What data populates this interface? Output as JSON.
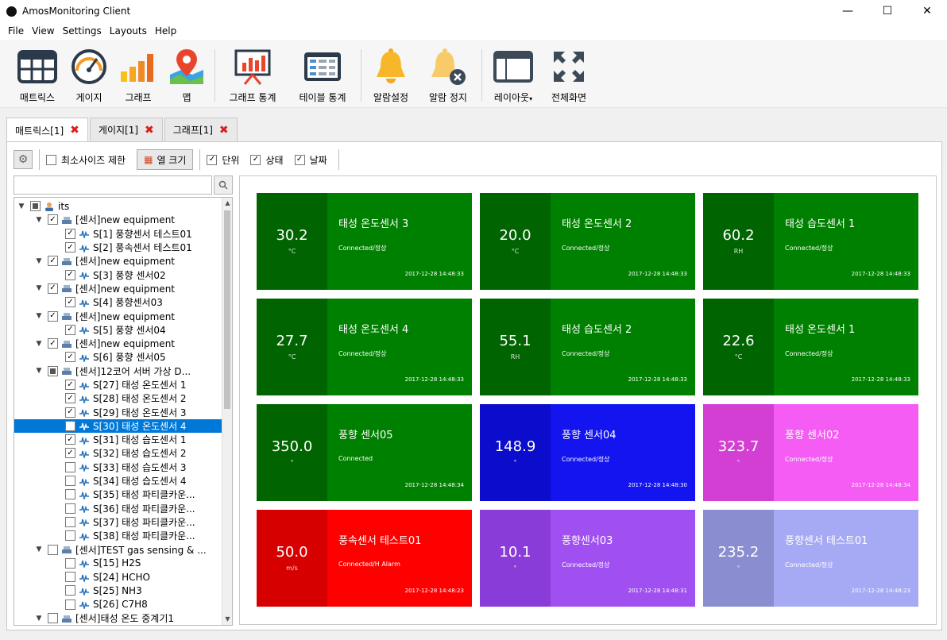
{
  "window": {
    "title": "AmosMonitoring Client",
    "min": "—",
    "max": "☐",
    "close": "✕"
  },
  "menu": [
    "File",
    "View",
    "Settings",
    "Layouts",
    "Help"
  ],
  "toolbar": {
    "buttons": [
      {
        "label": "매트릭스",
        "icon": "matrix-icon"
      },
      {
        "label": "게이지",
        "icon": "gauge-icon"
      },
      {
        "label": "그래프",
        "icon": "bar-graph-icon"
      },
      {
        "label": "맵",
        "icon": "map-icon"
      },
      {
        "label": "그래프 통계",
        "icon": "graph-stats-icon"
      },
      {
        "label": "테이블 통계",
        "icon": "table-stats-icon"
      },
      {
        "label": "알람설정",
        "icon": "bell-icon"
      },
      {
        "label": "알람 정지",
        "icon": "bell-stop-icon"
      },
      {
        "label": "레이아웃",
        "icon": "layout-icon"
      },
      {
        "label": "전체화면",
        "icon": "fullscreen-icon"
      }
    ]
  },
  "tabs": [
    {
      "label": "매트릭스[1]"
    },
    {
      "label": "게이지[1]"
    },
    {
      "label": "그래프[1]"
    }
  ],
  "options": {
    "min_size": "최소사이즈 제한",
    "col_size": "열 크기",
    "unit": "단위",
    "status": "상태",
    "date": "날짜"
  },
  "search": {
    "placeholder": ""
  },
  "tree": [
    {
      "indent": 0,
      "tri": "▼",
      "check": "partial",
      "icon": "user",
      "label": "its"
    },
    {
      "indent": 1,
      "tri": "▼",
      "check": "on",
      "icon": "device",
      "label": "[센서]new equipment"
    },
    {
      "indent": 2,
      "tri": "",
      "check": "on",
      "icon": "sensor",
      "label": "S[1] 풍향센서 테스트01"
    },
    {
      "indent": 2,
      "tri": "",
      "check": "on",
      "icon": "sensor",
      "label": "S[2] 풍속센서 테스트01"
    },
    {
      "indent": 1,
      "tri": "▼",
      "check": "on",
      "icon": "device",
      "label": "[센서]new equipment"
    },
    {
      "indent": 2,
      "tri": "",
      "check": "on",
      "icon": "sensor",
      "label": "S[3] 풍향 센서02"
    },
    {
      "indent": 1,
      "tri": "▼",
      "check": "on",
      "icon": "device",
      "label": "[센서]new equipment"
    },
    {
      "indent": 2,
      "tri": "",
      "check": "on",
      "icon": "sensor",
      "label": "S[4] 풍향센서03"
    },
    {
      "indent": 1,
      "tri": "▼",
      "check": "on",
      "icon": "device",
      "label": "[센서]new equipment"
    },
    {
      "indent": 2,
      "tri": "",
      "check": "on",
      "icon": "sensor",
      "label": "S[5] 풍향 센서04"
    },
    {
      "indent": 1,
      "tri": "▼",
      "check": "on",
      "icon": "device",
      "label": "[센서]new equipment"
    },
    {
      "indent": 2,
      "tri": "",
      "check": "on",
      "icon": "sensor",
      "label": "S[6] 풍향 센서05"
    },
    {
      "indent": 1,
      "tri": "▼",
      "check": "partial",
      "icon": "device",
      "label": "[센서]12코어 서버 가상 D..."
    },
    {
      "indent": 2,
      "tri": "",
      "check": "on",
      "icon": "sensor",
      "label": "S[27] 태성 온도센서 1"
    },
    {
      "indent": 2,
      "tri": "",
      "check": "on",
      "icon": "sensor",
      "label": "S[28] 태성 온도센서 2"
    },
    {
      "indent": 2,
      "tri": "",
      "check": "on",
      "icon": "sensor",
      "label": "S[29] 태성 온도센서 3"
    },
    {
      "indent": 2,
      "tri": "",
      "check": "on",
      "icon": "sensor",
      "label": "S[30] 태성 온도센서 4",
      "selected": true
    },
    {
      "indent": 2,
      "tri": "",
      "check": "on",
      "icon": "sensor",
      "label": "S[31] 태성 습도센서 1"
    },
    {
      "indent": 2,
      "tri": "",
      "check": "on",
      "icon": "sensor",
      "label": "S[32] 태성 습도센서 2"
    },
    {
      "indent": 2,
      "tri": "",
      "check": "off",
      "icon": "sensor",
      "label": "S[33] 태성 습도센서 3"
    },
    {
      "indent": 2,
      "tri": "",
      "check": "off",
      "icon": "sensor",
      "label": "S[34] 태성 습도센서 4"
    },
    {
      "indent": 2,
      "tri": "",
      "check": "off",
      "icon": "sensor",
      "label": "S[35] 태성 파티클카운..."
    },
    {
      "indent": 2,
      "tri": "",
      "check": "off",
      "icon": "sensor",
      "label": "S[36] 태성 파티클카운..."
    },
    {
      "indent": 2,
      "tri": "",
      "check": "off",
      "icon": "sensor",
      "label": "S[37] 태성 파티클카운..."
    },
    {
      "indent": 2,
      "tri": "",
      "check": "off",
      "icon": "sensor",
      "label": "S[38] 태성 파티클카운..."
    },
    {
      "indent": 1,
      "tri": "▼",
      "check": "off",
      "icon": "device",
      "label": "[센서]TEST gas sensing & ..."
    },
    {
      "indent": 2,
      "tri": "",
      "check": "off",
      "icon": "sensor",
      "label": "S[15] H2S"
    },
    {
      "indent": 2,
      "tri": "",
      "check": "off",
      "icon": "sensor",
      "label": "S[24] HCHO"
    },
    {
      "indent": 2,
      "tri": "",
      "check": "off",
      "icon": "sensor",
      "label": "S[25] NH3"
    },
    {
      "indent": 2,
      "tri": "",
      "check": "off",
      "icon": "sensor",
      "label": "S[26] C7H8"
    },
    {
      "indent": 1,
      "tri": "▼",
      "check": "off",
      "icon": "device",
      "label": "[센서]태성 온도 중계기1"
    }
  ],
  "tiles": [
    {
      "value": "30.2",
      "unit": "°C",
      "name": "태성 온도센서 3",
      "status": "Connected/정상",
      "date": "2017-12-28 14:48:33",
      "left": "#006400",
      "right": "#008000"
    },
    {
      "value": "20.0",
      "unit": "°C",
      "name": "태성 온도센서 2",
      "status": "Connected/정상",
      "date": "2017-12-28 14:48:33",
      "left": "#006400",
      "right": "#008000"
    },
    {
      "value": "60.2",
      "unit": "RH",
      "name": "태성 습도센서 1",
      "status": "Connected/정상",
      "date": "2017-12-28 14:48:33",
      "left": "#006400",
      "right": "#008000"
    },
    {
      "value": "27.7",
      "unit": "°C",
      "name": "태성 온도센서 4",
      "status": "Connected/정상",
      "date": "2017-12-28 14:48:33",
      "left": "#006400",
      "right": "#008000"
    },
    {
      "value": "55.1",
      "unit": "RH",
      "name": "태성 습도센서 2",
      "status": "Connected/정상",
      "date": "2017-12-28 14:48:33",
      "left": "#006400",
      "right": "#008000"
    },
    {
      "value": "22.6",
      "unit": "°C",
      "name": "태성 온도센서 1",
      "status": "Connected/정상",
      "date": "2017-12-28 14:48:33",
      "left": "#006400",
      "right": "#008000"
    },
    {
      "value": "350.0",
      "unit": "°",
      "name": "풍향 센서05",
      "status": "Connected",
      "date": "2017-12-28 14:48:34",
      "left": "#006400",
      "right": "#008000"
    },
    {
      "value": "148.9",
      "unit": "°",
      "name": "풍향 센서04",
      "status": "Connected/정상",
      "date": "2017-12-28 14:48:30",
      "left": "#0c0ccc",
      "right": "#1414f0"
    },
    {
      "value": "323.7",
      "unit": "°",
      "name": "풍향 센서02",
      "status": "Connected/정상",
      "date": "2017-12-28 14:48:34",
      "left": "#d23fd2",
      "right": "#f45cf4"
    },
    {
      "value": "50.0",
      "unit": "m/s",
      "name": "풍속센서 테스트01",
      "status": "Connected/H Alarm",
      "date": "2017-12-28 14:48:23",
      "left": "#d60000",
      "right": "#fe0000"
    },
    {
      "value": "10.1",
      "unit": "°",
      "name": "풍향센서03",
      "status": "Connected/정상",
      "date": "2017-12-28 14:48:31",
      "left": "#8a3cd8",
      "right": "#a050f0"
    },
    {
      "value": "235.2",
      "unit": "°",
      "name": "풍향센서 테스트01",
      "status": "Connected/정상",
      "date": "2017-12-28 14:48:23",
      "left": "#8a8ed0",
      "right": "#a6aaf4"
    }
  ]
}
